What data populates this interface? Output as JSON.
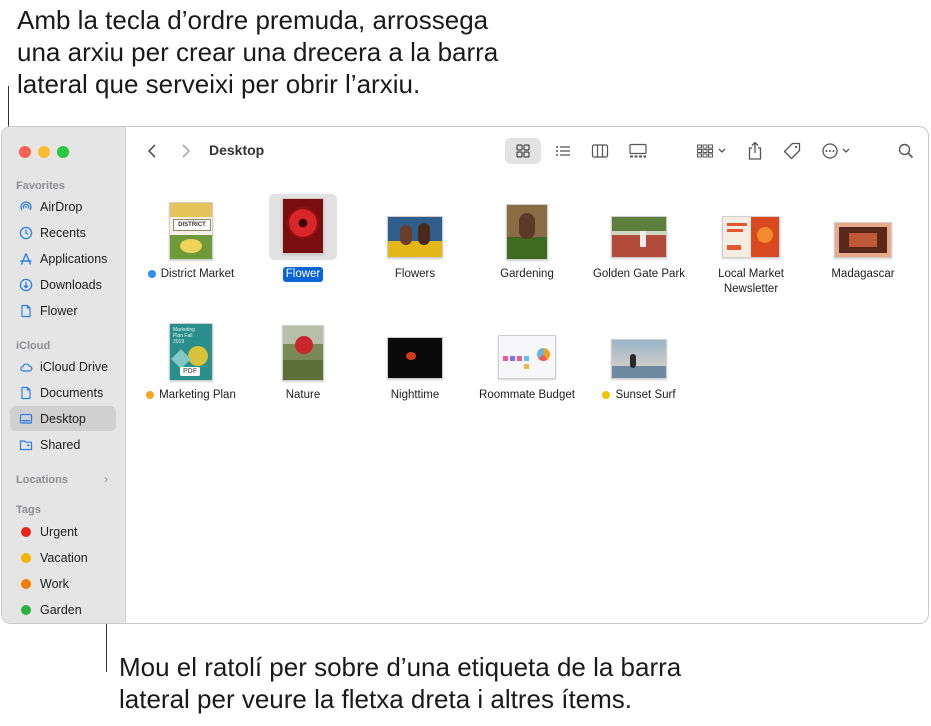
{
  "callouts": {
    "top": [
      "Amb la tecla d’ordre premuda, arrossega",
      "una arxiu per crear una drecera a la barra",
      "lateral que serveixi per obrir l’arxiu."
    ],
    "bottom": [
      "Mou el ratolí per sobre d’una etiqueta de la barra",
      "lateral per veure la fletxa dreta i altres ítems."
    ]
  },
  "window": {
    "title": "Desktop"
  },
  "sidebar": {
    "sections": {
      "favorites": "Favorites",
      "icloud": "iCloud",
      "locations": "Locations",
      "tags": "Tags"
    },
    "favorites": [
      {
        "label": "AirDrop",
        "icon": "airdrop-icon"
      },
      {
        "label": "Recents",
        "icon": "clock-icon"
      },
      {
        "label": "Applications",
        "icon": "applications-icon"
      },
      {
        "label": "Downloads",
        "icon": "download-icon"
      },
      {
        "label": "Flower",
        "icon": "document-icon"
      }
    ],
    "icloud": [
      {
        "label": "iCloud Drive",
        "icon": "cloud-icon"
      },
      {
        "label": "Documents",
        "icon": "document-icon"
      },
      {
        "label": "Desktop",
        "icon": "desktop-icon",
        "selected": true
      },
      {
        "label": "Shared",
        "icon": "shared-folder-icon"
      }
    ],
    "locations_chevron": "›",
    "tags": [
      {
        "label": "Urgent",
        "color": "#e8221c"
      },
      {
        "label": "Vacation",
        "color": "#f5b400"
      },
      {
        "label": "Work",
        "color": "#f57c00"
      },
      {
        "label": "Garden",
        "color": "#28b33e"
      }
    ]
  },
  "toolbar": {
    "back": "chevron-left-icon",
    "forward": "chevron-right-icon",
    "views": [
      "icon-view-icon",
      "list-view-icon",
      "column-view-icon",
      "gallery-view-icon"
    ],
    "active_view": "icon-view-icon",
    "actions": [
      "group-by-icon",
      "share-icon",
      "tag-icon",
      "more-icon",
      "search-icon"
    ]
  },
  "files": [
    {
      "label": "District Market",
      "tag": "#2f8ef0",
      "thumb": "district"
    },
    {
      "label": "Flower",
      "selected": true,
      "thumb": "flower"
    },
    {
      "label": "Flowers",
      "thumb": "flowers"
    },
    {
      "label": "Gardening",
      "thumb": "gardening"
    },
    {
      "label": "Golden Gate Park",
      "thumb": "park"
    },
    {
      "label": "Local Market Newsletter",
      "thumb": "newsletter"
    },
    {
      "label": "Madagascar",
      "thumb": "madagascar"
    },
    {
      "label": "Marketing Plan",
      "tag": "#f5a623",
      "thumb": "marketing"
    },
    {
      "label": "Nature",
      "thumb": "nature"
    },
    {
      "label": "Nighttime",
      "thumb": "night"
    },
    {
      "label": "Roommate Budget",
      "thumb": "budget"
    },
    {
      "label": "Sunset Surf",
      "tag": "#f5c400",
      "thumb": "surf"
    }
  ],
  "thumb_text": {
    "district_title": "DISTRICT",
    "pdf_badge": "PDF",
    "marketing_title": "Marketing Plan Fall 2019"
  }
}
